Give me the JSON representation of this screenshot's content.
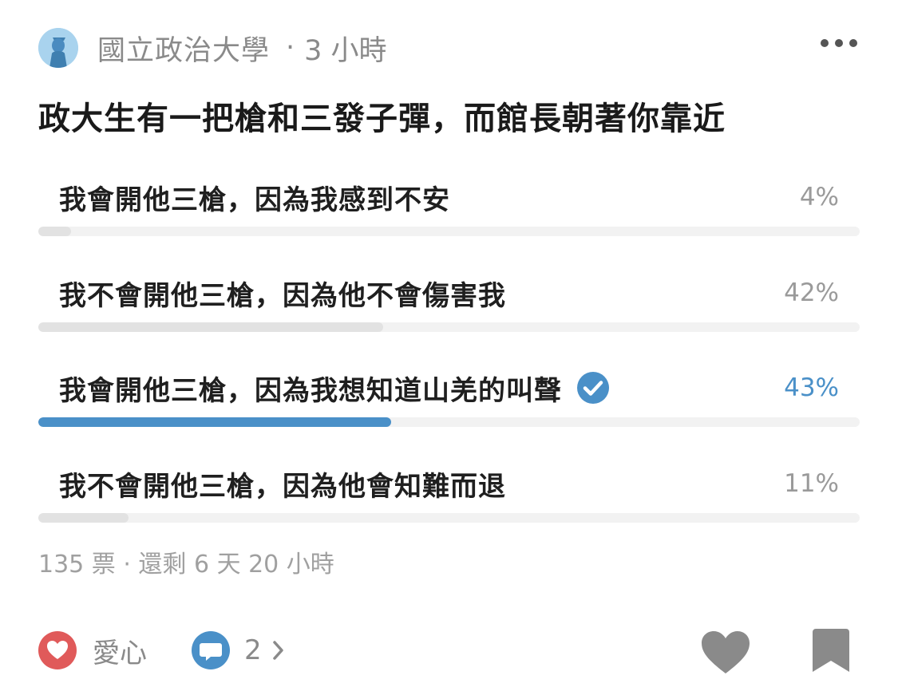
{
  "post": {
    "author": "國立政治大學",
    "separator": "·",
    "time": "3 小時",
    "title": "政大生有一把槍和三發子彈，而館長朝著你靠近"
  },
  "poll": {
    "options": [
      {
        "label": "我會開他三槍，因為我感到不安",
        "percent_text": "4%",
        "percent": 4,
        "selected": false
      },
      {
        "label": "我不會開他三槍，因為他不會傷害我",
        "percent_text": "42%",
        "percent": 42,
        "selected": false
      },
      {
        "label": "我會開他三槍，因為我想知道山羌的叫聲",
        "percent_text": "43%",
        "percent": 43,
        "selected": true
      },
      {
        "label": "我不會開他三槍，因為他會知難而退",
        "percent_text": "11%",
        "percent": 11,
        "selected": false
      }
    ],
    "meta": "135 票 · 還剩 6 天 20 小時"
  },
  "actions": {
    "like_label": "愛心",
    "comment_count": "2"
  },
  "colors": {
    "accent": "#4a90c8",
    "like_red": "#e05a5a",
    "comment_blue": "#4a90c8",
    "muted": "#8a8a8a"
  },
  "icons": {
    "avatar": "avatar-icon",
    "more": "more-icon",
    "check": "check-circle-icon",
    "like": "heart-circle-icon",
    "comment": "comment-bubble-icon",
    "chevron": "chevron-right-icon",
    "heart": "heart-icon",
    "bookmark": "bookmark-icon"
  }
}
